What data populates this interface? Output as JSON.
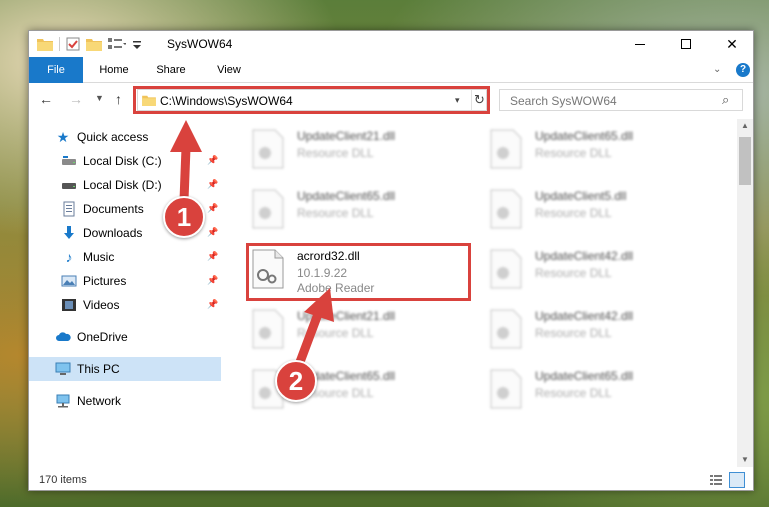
{
  "window": {
    "title": "SysWOW64",
    "qat_icons": [
      "folder-icon",
      "properties-icon",
      "new-folder-icon",
      "customize-icon",
      "dropdown-icon"
    ]
  },
  "ribbon": {
    "tabs": [
      {
        "label": "File",
        "active": true
      },
      {
        "label": "Home"
      },
      {
        "label": "Share"
      },
      {
        "label": "View"
      }
    ],
    "accent": "#1979ca"
  },
  "nav": {
    "address": "C:\\Windows\\SysWOW64",
    "search_placeholder": "Search SysWOW64"
  },
  "sidebar": {
    "quick_access": "Quick access",
    "items": [
      {
        "label": "Local Disk (C:)",
        "icon": "drive-icon",
        "pinned": true
      },
      {
        "label": "Local Disk (D:)",
        "icon": "drive-icon",
        "pinned": true
      },
      {
        "label": "Documents",
        "icon": "documents-icon",
        "pinned": true
      },
      {
        "label": "Downloads",
        "icon": "downloads-icon",
        "pinned": true
      },
      {
        "label": "Music",
        "icon": "music-icon",
        "pinned": true
      },
      {
        "label": "Pictures",
        "icon": "pictures-icon",
        "pinned": true
      },
      {
        "label": "Videos",
        "icon": "videos-icon",
        "pinned": true
      }
    ],
    "onedrive": "OneDrive",
    "this_pc": "This PC",
    "network": "Network",
    "selected": "This PC"
  },
  "files": [
    {
      "name": "UpdateClient21.dll",
      "type": "Resource DLL",
      "blurred": true
    },
    {
      "name": "UpdateClient65.dll",
      "type": "Resource DLL",
      "blurred": true
    },
    {
      "name": "UpdateClient65.dll",
      "type": "Resource DLL",
      "blurred": true
    },
    {
      "name": "UpdateClient5.dll",
      "type": "Resource DLL",
      "blurred": true
    },
    {
      "name": "acrord32.dll",
      "version": "10.1.9.22",
      "company": "Adobe Reader",
      "blurred": false
    },
    {
      "name": "UpdateClient42.dll",
      "type": "Resource DLL",
      "blurred": true
    },
    {
      "name": "UpdateClient21.dll",
      "type": "Resource DLL",
      "blurred": true
    },
    {
      "name": "UpdateClient42.dll",
      "type": "Resource DLL",
      "blurred": true
    },
    {
      "name": "UpdateClient65.dll",
      "type": "Resource DLL",
      "blurred": true
    },
    {
      "name": "UpdateClient65.dll",
      "type": "Resource DLL",
      "blurred": true
    }
  ],
  "status": {
    "items_count": "170 items"
  },
  "annotations": {
    "step1": "1",
    "step2": "2",
    "color": "#d9423d"
  }
}
